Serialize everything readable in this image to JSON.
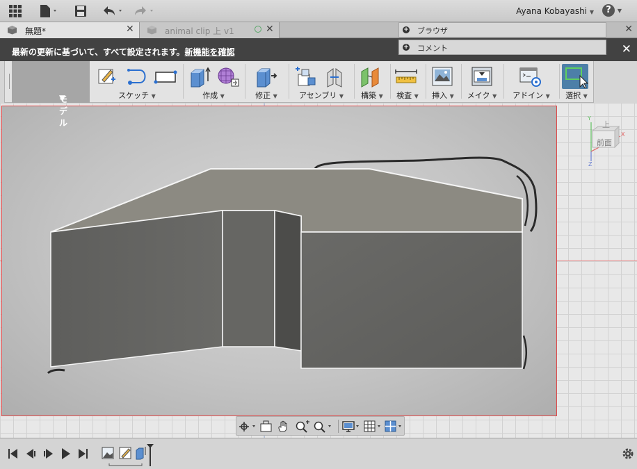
{
  "appbar": {
    "user_name": "Ayana Kobayashi",
    "help_glyph": "?",
    "icons": [
      "grid-icon",
      "file-icon",
      "save-icon",
      "undo-icon",
      "redo-icon",
      "help-icon"
    ]
  },
  "tabs": [
    {
      "label": "無題*",
      "active": true
    },
    {
      "label": "animal clip 上 v1",
      "active": false
    }
  ],
  "panels": {
    "browser": "ブラウザ",
    "comments": "コメント"
  },
  "banner": {
    "message": "最新の更新に基づいて、すべて設定されます。",
    "link": "新機能を確認"
  },
  "toolbar": {
    "workspace": "モデル",
    "groups": {
      "sketch": "スケッチ",
      "create": "作成",
      "modify": "修正",
      "assemble": "アセンブリ",
      "construct": "構築",
      "inspect": "検査",
      "insert": "挿入",
      "make": "メイク",
      "addins": "アドイン",
      "select": "選択"
    }
  },
  "viewcube": {
    "top": "上",
    "front": "前面",
    "axis_x": "X",
    "axis_y": "Y",
    "axis_z": "Z"
  },
  "colors": {
    "banner_bg": "#424242",
    "select_active": "#4d7fa8",
    "canvas_border": "#e04848",
    "box_side": "#626260",
    "box_top": "#8c8a82"
  }
}
